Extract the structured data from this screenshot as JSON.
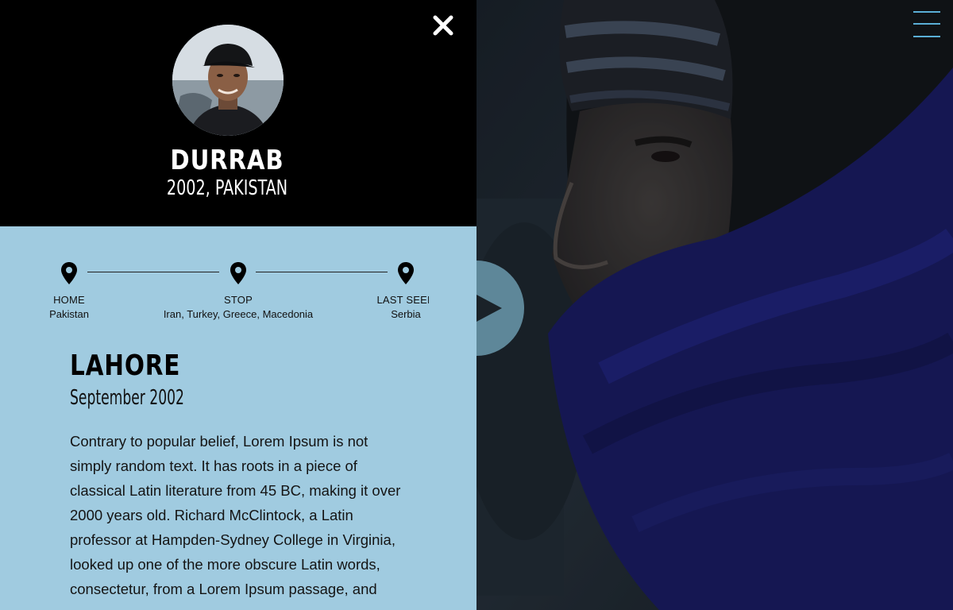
{
  "profile": {
    "name": "DURRAB",
    "subtitle": "2002, PAKISTAN"
  },
  "journey": {
    "stops": [
      {
        "label": "HOME",
        "value": "Pakistan"
      },
      {
        "label": "STOP",
        "value": "Iran, Turkey, Greece, Macedonia"
      },
      {
        "label": "LAST SEEN",
        "value": "Serbia"
      }
    ]
  },
  "story": {
    "place": "LAHORE",
    "date": "September 2002",
    "body": "Contrary to popular belief, Lorem Ipsum is not simply random text. It has roots in a piece of classical Latin literature from 45 BC, making it over 2000 years old. Richard McClintock, a Latin professor at Hampden-Sydney College in Virginia, looked up one of the more obscure Latin words, consectetur, from a Lorem Ipsum passage, and"
  },
  "icons": {
    "close": "close-icon",
    "menu": "hamburger-menu-icon",
    "play": "play-icon",
    "pin": "map-pin-icon"
  },
  "colors": {
    "panel_background": "#a0cbe0",
    "header_background": "#000000",
    "menu_accent": "#5aaed6",
    "play_button": "#5e8799"
  }
}
